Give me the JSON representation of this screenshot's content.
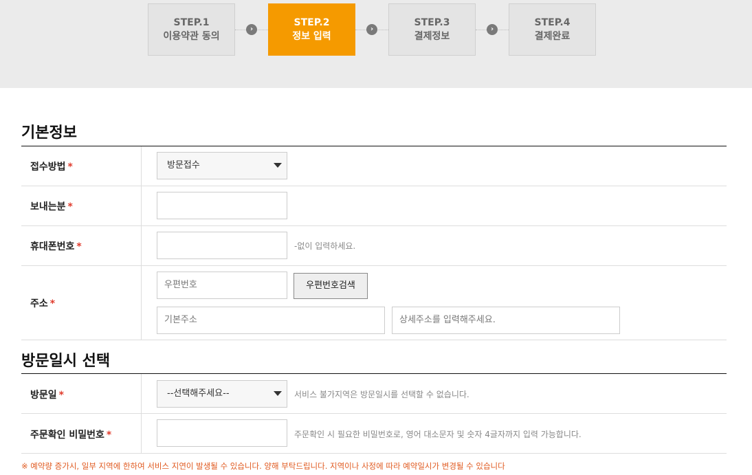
{
  "steps": [
    {
      "num": "STEP.1",
      "name": "이용약관 동의",
      "active": false
    },
    {
      "num": "STEP.2",
      "name": "정보 입력",
      "active": true
    },
    {
      "num": "STEP.3",
      "name": "결제정보",
      "active": false
    },
    {
      "num": "STEP.4",
      "name": "결제완료",
      "active": false
    }
  ],
  "basic_info": {
    "title": "기본정보",
    "reception_method": {
      "label": "접수방법",
      "value": "방문접수"
    },
    "sender": {
      "label": "보내는분",
      "value": ""
    },
    "phone": {
      "label": "휴대폰번호",
      "value": "",
      "hint": "-없이 입력하세요."
    },
    "address": {
      "label": "주소",
      "postcode_placeholder": "우편번호",
      "search_button": "우편번호검색",
      "base_placeholder": "기본주소",
      "detail_placeholder": "상세주소를 입력해주세요."
    }
  },
  "visit": {
    "title": "방문일시 선택",
    "visit_date": {
      "label": "방문일",
      "value": "--선택해주세요--",
      "hint": "서비스 불가지역은 방문일시를 선택할 수 없습니다."
    },
    "order_password": {
      "label": "주문확인 비밀번호",
      "value": "",
      "hint": "주문확인 시 필요한 비밀번호로, 영어 대소문자 및 숫자 4글자까지 입력 가능합니다."
    }
  },
  "required_mark": "*",
  "notice": "※ 예약량 증가시, 일부 지역에 한하여 서비스 지연이 발생될 수 있습니다. 양해 부탁드립니다. 지역이나 사정에 따라 예약일시가 변경될 수 있습니다",
  "colors": {
    "active_step": "#f59a00",
    "required": "#e03b2c",
    "notice": "#e05a20"
  }
}
